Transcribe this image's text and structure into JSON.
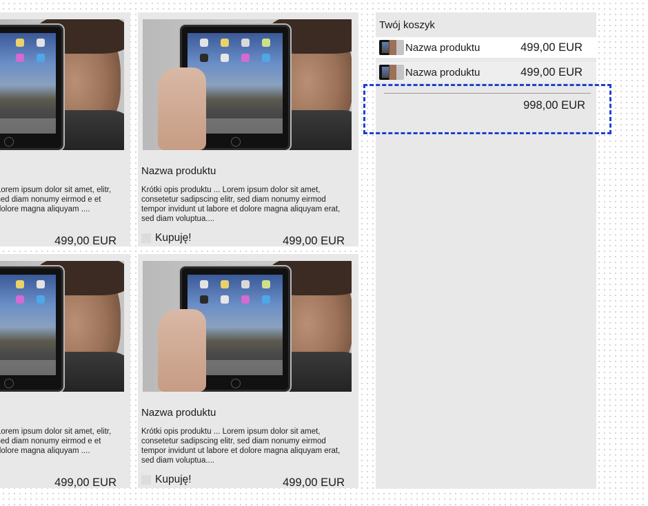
{
  "products": [
    {
      "id": "p1",
      "title": "",
      "desc": "Lorem ipsum dolor sit amet, elitr, sed diam nonumy eirmod e et dolore magna aliquyam ....",
      "buy_label": "",
      "price": "499,00 EUR"
    },
    {
      "id": "p2",
      "title": "Nazwa produktu",
      "desc": "Krótki opis produktu ... Lorem ipsum dolor sit amet, consetetur sadipscing elitr, sed diam nonumy eirmod tempor invidunt ut labore et dolore magna aliquyam erat, sed diam voluptua....",
      "buy_label": "Kupuję!",
      "price": "499,00 EUR"
    },
    {
      "id": "p3",
      "title": "",
      "desc": "Lorem ipsum dolor sit amet, elitr, sed diam nonumy eirmod e et dolore magna aliquyam ....",
      "buy_label": "",
      "price": "499,00 EUR"
    },
    {
      "id": "p4",
      "title": "Nazwa produktu",
      "desc": "Krótki opis produktu ... Lorem ipsum dolor sit amet, consetetur sadipscing elitr, sed diam nonumy eirmod tempor invidunt ut labore et dolore magna aliquyam erat, sed diam voluptua....",
      "buy_label": "Kupuję!",
      "price": "499,00 EUR"
    }
  ],
  "cart": {
    "title": "Twój koszyk",
    "items": [
      {
        "name": "Nazwa produktu",
        "price": "499,00 EUR"
      },
      {
        "name": "Nazwa produktu",
        "price": "499,00 EUR"
      }
    ],
    "total": "998,00 EUR"
  },
  "icons": {
    "product_image": "tablet-photo-image",
    "cart_thumb": "product-thumbnail-icon",
    "checkbox": "checkbox-icon"
  },
  "colors": {
    "panel_bg": "#e8e8e8",
    "highlight_border": "#1d3fd0"
  }
}
